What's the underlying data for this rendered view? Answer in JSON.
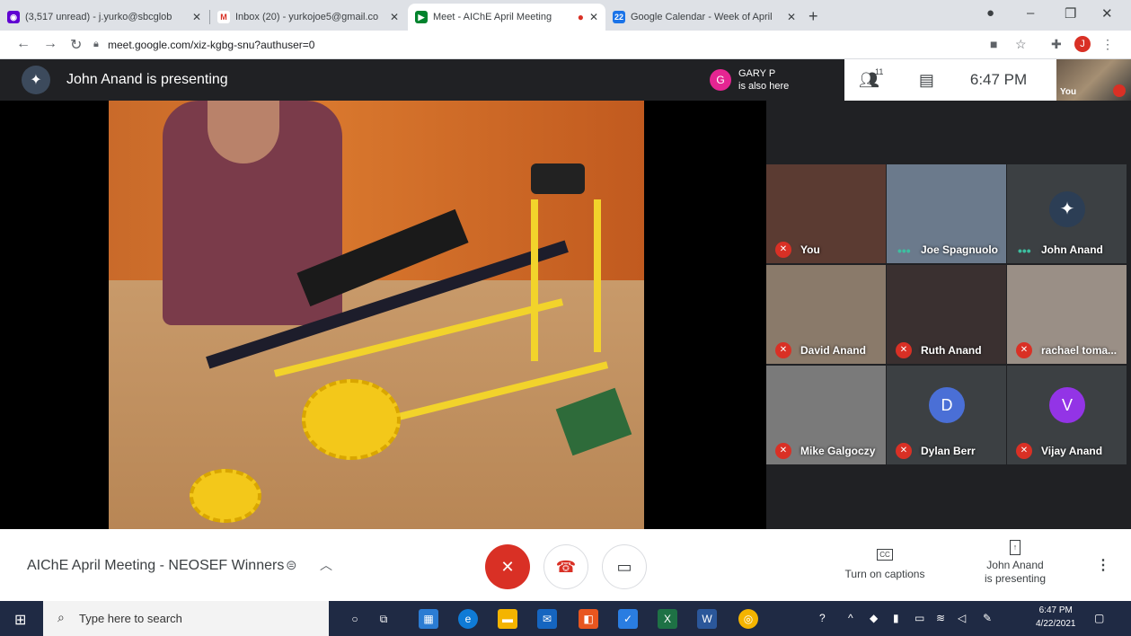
{
  "browser": {
    "tabs": [
      {
        "title": "(3,517 unread) - j.yurko@sbcglob",
        "fav_color": "#6001d2",
        "fav_glyph": "◉"
      },
      {
        "title": "Inbox (20) - yurkojoe5@gmail.co",
        "fav_color": "#d93025",
        "fav_glyph": "M"
      },
      {
        "title": "Meet - AIChE April Meeting",
        "fav_color": "#00832d",
        "fav_glyph": "▶"
      },
      {
        "title": "Google Calendar - Week of April",
        "fav_color": "#1a73e8",
        "fav_glyph": "22"
      }
    ],
    "new_tab": "+",
    "url": "meet.google.com/xiz-kgbg-snu?authuser=0",
    "profile_initial": "J"
  },
  "meet": {
    "presenter_banner": "John Anand is presenting",
    "also_here": {
      "initial": "G",
      "name": "GARY P",
      "status": "is also here"
    },
    "people_count": "11",
    "clock": "6:47 PM",
    "self_label": "You",
    "tiles": [
      {
        "name": "You",
        "muted": true,
        "bg": "#5b3b32"
      },
      {
        "name": "Joe Spagnuolo",
        "muted": false,
        "bg": "#6b7a8c"
      },
      {
        "name": "John Anand",
        "muted": false,
        "bg": "#3c4043",
        "logo": true
      },
      {
        "name": "David Anand",
        "muted": true,
        "bg": "#8a7a6a"
      },
      {
        "name": "Ruth Anand",
        "muted": true,
        "bg": "#3a3030"
      },
      {
        "name": "rachael toma...",
        "muted": true,
        "bg": "#9a8f86"
      },
      {
        "name": "Mike Galgoczy",
        "muted": true,
        "bg": "#7a7a7a"
      },
      {
        "name": "Dylan Berr",
        "muted": true,
        "bg": "#3c4043",
        "letter": "D",
        "letter_color": "#4a6fd6"
      },
      {
        "name": "Vijay Anand",
        "muted": true,
        "bg": "#3c4043",
        "letter": "V",
        "letter_color": "#9334e6"
      }
    ],
    "meeting_title": "AIChE April Meeting - NEOSEF Winners",
    "captions_label": "Turn on captions",
    "presenting_line1": "John Anand",
    "presenting_line2": "is presenting"
  },
  "taskbar": {
    "search_placeholder": "Type here to search",
    "time": "6:47 PM",
    "date": "4/22/2021"
  }
}
